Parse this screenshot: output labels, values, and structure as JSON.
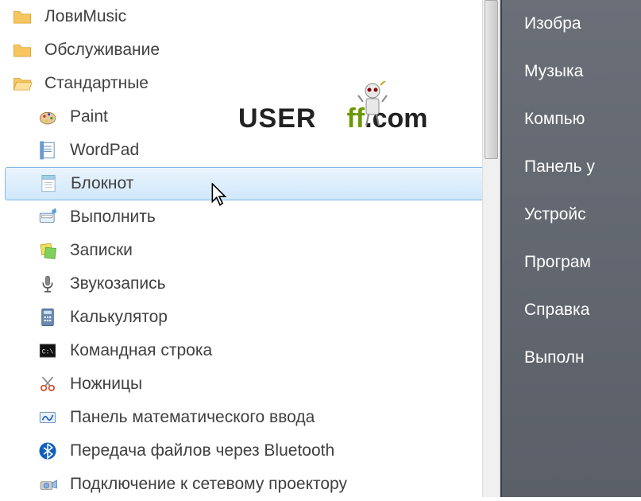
{
  "left": {
    "items": [
      {
        "label": "ЛовиMusic",
        "icon": "folder",
        "sub": false
      },
      {
        "label": "Обслуживание",
        "icon": "folder",
        "sub": false
      },
      {
        "label": "Стандартные",
        "icon": "folder-open",
        "sub": false
      },
      {
        "label": "Paint",
        "icon": "paint",
        "sub": true
      },
      {
        "label": "WordPad",
        "icon": "wordpad",
        "sub": true
      },
      {
        "label": "Блокнот",
        "icon": "notepad",
        "sub": true,
        "selected": true
      },
      {
        "label": "Выполнить",
        "icon": "run",
        "sub": true
      },
      {
        "label": "Записки",
        "icon": "notes",
        "sub": true
      },
      {
        "label": "Звукозапись",
        "icon": "mic",
        "sub": true
      },
      {
        "label": "Калькулятор",
        "icon": "calc",
        "sub": true
      },
      {
        "label": "Командная строка",
        "icon": "cmd",
        "sub": true
      },
      {
        "label": "Ножницы",
        "icon": "snip",
        "sub": true
      },
      {
        "label": "Панель математического ввода",
        "icon": "math",
        "sub": true
      },
      {
        "label": "Передача файлов через Bluetooth",
        "icon": "bluetooth",
        "sub": true
      },
      {
        "label": "Подключение к сетевому проектору",
        "icon": "projector",
        "sub": true
      }
    ]
  },
  "right": {
    "items": [
      "Изобра",
      "Музыка",
      "Компью",
      "Панель у",
      "Устройс",
      "Програм",
      "Справка",
      "Выполн"
    ]
  },
  "watermark": {
    "user": "USER",
    "off": "ff",
    "com": ".com"
  }
}
